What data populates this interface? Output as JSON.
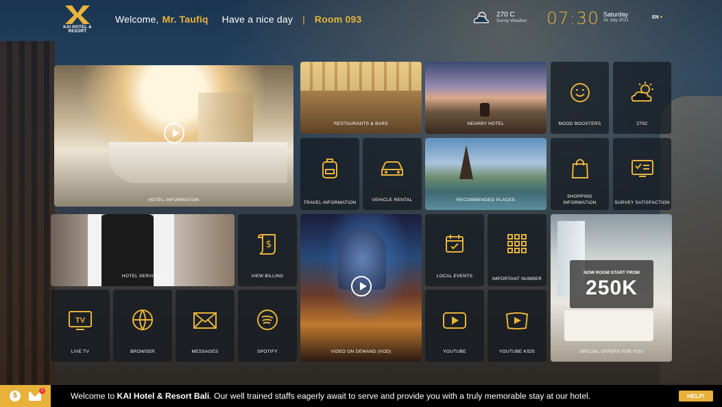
{
  "header": {
    "logo_text": "KAI HOTEL & RESORT",
    "welcome_prefix": "Welcome,",
    "guest_name": "Mr. Taufiq",
    "greeting": "Have a nice day",
    "separator": "|",
    "room": "Room 093",
    "weather_temp": "270 C",
    "weather_desc": "Sunny Weather",
    "time": "07:30",
    "day": "Saturday",
    "date": "31 July 2021",
    "language": "EN"
  },
  "tiles": {
    "hotel_information": "HOTEL INFORMATION",
    "restaurants_bars": "RESTAURANTS & BARS",
    "nearby_hotel": "NEARBY HOTEL",
    "mood_boosters": "MOOD BOOSTERS",
    "weather": "270C",
    "travel_information": "TRAVEL INFORMATION",
    "vehicle_rental": "VEHICLE RENTAL",
    "recommended_places": "RECOMMENDED PLACES",
    "shopping_information": "SHOPPING INFORMATION",
    "survey_satisfaction": "SURVEY SATISFACTION",
    "hotel_services": "HOTEL SERVICES",
    "view_billing": "VIEW BILLING",
    "video_on_demand": "VIDEO ON DEMAND (VOD)",
    "local_events": "LOCAL EVENTS",
    "important_number": "IMPORTANT NUMBER",
    "special_offers": "SPECIAL OFFERS FOR YOU",
    "live_tv": "LIVE TV",
    "browser": "BROWSER",
    "messages": "MESSAGES",
    "spotify": "SPOTIFY",
    "youtube": "YOUTUBE",
    "youtube_kids": "YOUTUBE KIDS"
  },
  "offer": {
    "subtitle": "NOW ROOM START FROM",
    "price": "250K"
  },
  "footer": {
    "coin_symbol": "$",
    "mail_badge": "1",
    "ticker_prefix": "Welcome to ",
    "ticker_bold": "KAI Hotel & Resort Bali",
    "ticker_suffix": ". Our well trained staffs eagerly await to serve and provide you with a truly memorable stay at our hotel.",
    "help_label": "HELP!"
  },
  "colors": {
    "accent": "#e9b43a",
    "tile_bg": "#141920"
  }
}
